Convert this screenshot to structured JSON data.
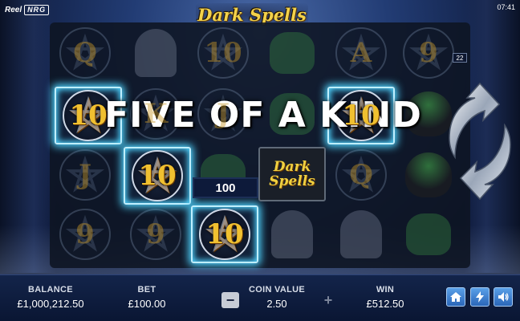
{
  "header": {
    "brand_reel": "Reel",
    "brand_nrg": "NRG",
    "title": "Dark Spells",
    "clock": "07:41"
  },
  "reels": {
    "grid": [
      [
        "Q",
        "ghost",
        "10",
        "frog",
        "A",
        "9"
      ],
      [
        "10",
        "K",
        "J",
        "frog",
        "10",
        "cauldron"
      ],
      [
        "J",
        "10",
        "frog",
        "Dark Spells",
        "Q",
        "cauldron"
      ],
      [
        "9",
        "9",
        "10",
        "ghost",
        "ghost",
        "frog"
      ]
    ],
    "winning_symbol": "10",
    "scatter_text_top": "Dark",
    "scatter_text_bottom": "Spells",
    "win_amount": "100",
    "win_message": "FIVE OF A KIND",
    "payline_number": "22"
  },
  "footer": {
    "balance_label": "BALANCE",
    "balance_value": "£1,000,212.50",
    "bet_label": "BET",
    "bet_value": "£100.00",
    "coin_label": "COIN VALUE",
    "coin_value": "2.50",
    "win_label": "WIN",
    "win_value": "£512.50",
    "minus": "−",
    "plus": "+"
  },
  "icons": {
    "spin": "spin-arrows-icon",
    "home": "home-icon",
    "turbo": "lightning-icon",
    "sound": "speaker-icon"
  },
  "colors": {
    "win_glow": "#4fd4ff",
    "symbol_gold": "#f0c030",
    "bar_bg": "#13244a"
  }
}
